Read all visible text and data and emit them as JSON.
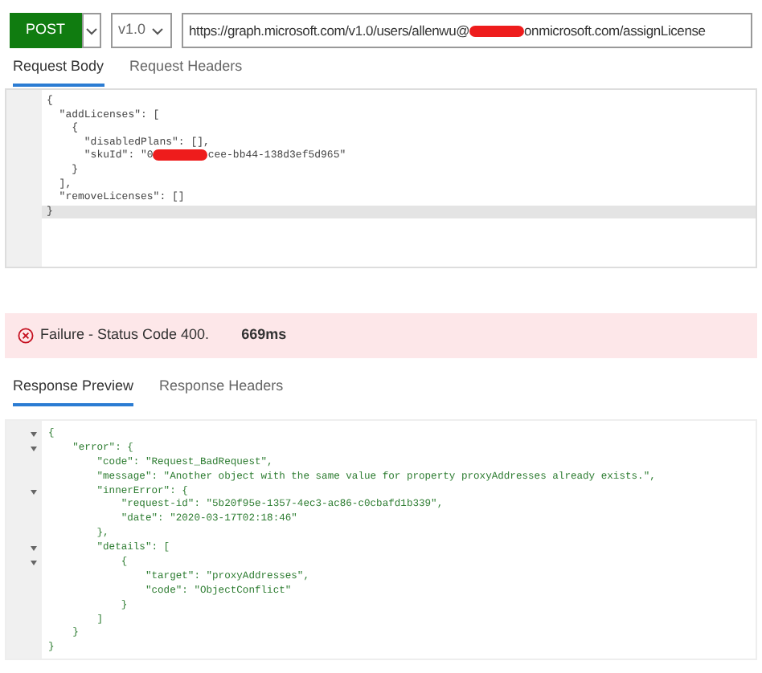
{
  "request_bar": {
    "method": "POST",
    "version": "v1.0",
    "url_parts": [
      {
        "kind": "text",
        "text": "https://graph.microsoft.com/v1.0/users/allenwu@"
      },
      {
        "kind": "redaction"
      },
      {
        "kind": "text",
        "text": "onmicrosoft.com/assignLicense"
      }
    ]
  },
  "request_tabs": [
    {
      "label": "Request Body",
      "selected": true
    },
    {
      "label": "Request Headers",
      "selected": false
    }
  ],
  "request_body": {
    "lines": [
      {
        "current": false,
        "parts": [
          {
            "kind": "text",
            "text": "{"
          }
        ]
      },
      {
        "current": false,
        "parts": [
          {
            "kind": "text",
            "text": "  \"addLicenses\": ["
          }
        ]
      },
      {
        "current": false,
        "parts": [
          {
            "kind": "text",
            "text": "    {"
          }
        ]
      },
      {
        "current": false,
        "parts": [
          {
            "kind": "text",
            "text": "      \"disabledPlans\": [],"
          }
        ]
      },
      {
        "current": false,
        "parts": [
          {
            "kind": "text",
            "text": "      \"skuId\": \"0"
          },
          {
            "kind": "redaction"
          },
          {
            "kind": "text",
            "text": "cee-bb44-138d3ef5d965\""
          }
        ]
      },
      {
        "current": false,
        "parts": [
          {
            "kind": "text",
            "text": "    }"
          }
        ]
      },
      {
        "current": false,
        "parts": [
          {
            "kind": "text",
            "text": "  ],"
          }
        ]
      },
      {
        "current": false,
        "parts": [
          {
            "kind": "text",
            "text": "  \"removeLicenses\": []"
          }
        ]
      },
      {
        "current": true,
        "parts": [
          {
            "kind": "text",
            "text": "}"
          }
        ]
      }
    ]
  },
  "status": {
    "kind": "failure",
    "message": "Failure - Status Code 400.",
    "duration": "669ms"
  },
  "response_tabs": [
    {
      "label": "Response Preview",
      "selected": true
    },
    {
      "label": "Response Headers",
      "selected": false
    }
  ],
  "response_body": {
    "lines": [
      {
        "foldable": true,
        "text": "{"
      },
      {
        "foldable": true,
        "text": "    \"error\": {"
      },
      {
        "foldable": false,
        "text": "        \"code\": \"Request_BadRequest\","
      },
      {
        "foldable": false,
        "text": "        \"message\": \"Another object with the same value for property proxyAddresses already exists.\","
      },
      {
        "foldable": true,
        "text": "        \"innerError\": {"
      },
      {
        "foldable": false,
        "text": "            \"request-id\": \"5b20f95e-1357-4ec3-ac86-c0cbafd1b339\","
      },
      {
        "foldable": false,
        "text": "            \"date\": \"2020-03-17T02:18:46\""
      },
      {
        "foldable": false,
        "text": "        },"
      },
      {
        "foldable": true,
        "text": "        \"details\": ["
      },
      {
        "foldable": true,
        "text": "            {"
      },
      {
        "foldable": false,
        "text": "                \"target\": \"proxyAddresses\","
      },
      {
        "foldable": false,
        "text": "                \"code\": \"ObjectConflict\""
      },
      {
        "foldable": false,
        "text": "            }"
      },
      {
        "foldable": false,
        "text": "        ]"
      },
      {
        "foldable": false,
        "text": "    }"
      },
      {
        "foldable": false,
        "text": "}"
      }
    ]
  }
}
